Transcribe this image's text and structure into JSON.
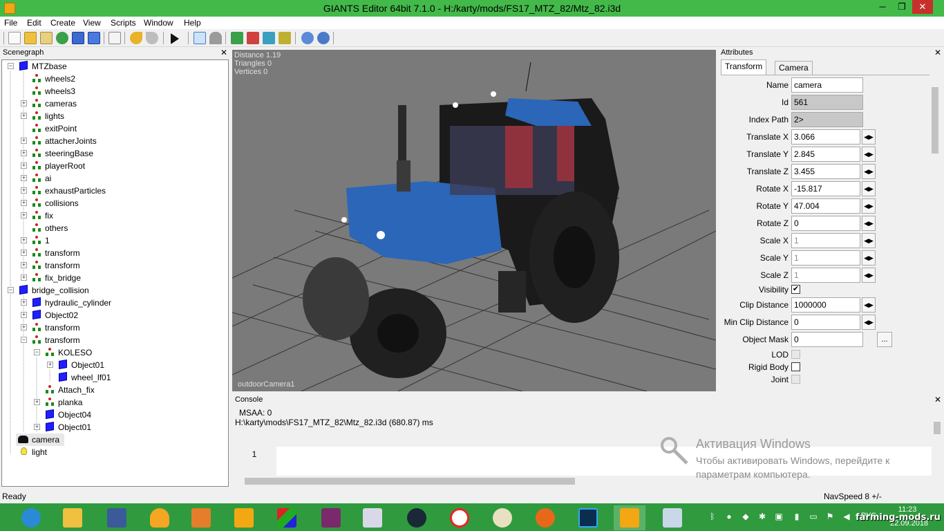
{
  "window": {
    "title": "GIANTS Editor 64bit 7.1.0 - H:/karty/mods/FS17_MTZ_82/Mtz_82.i3d",
    "minimize": "─",
    "maximize": "❐",
    "close": "✕"
  },
  "menu": [
    "File",
    "Edit",
    "Create",
    "View",
    "Scripts",
    "Window",
    "Help"
  ],
  "scenegraph": {
    "title": "Scenegraph",
    "close": "✕",
    "nodes": [
      "MTZbase",
      "wheels2",
      "wheels3",
      "cameras",
      "lights",
      "exitPoint",
      "attacherJoints",
      "steeringBase",
      "playerRoot",
      "ai",
      "exhaustParticles",
      "collisions",
      "fix",
      "others",
      "1",
      "transform",
      "transform",
      "fix_bridge",
      "bridge_collision",
      "hydraulic_cylinder",
      "Object02",
      "transform",
      "transform",
      "KOLESO",
      "Object01",
      "wheel_lf01",
      "Attach_fix",
      "planka",
      "Object04",
      "Object01",
      "camera",
      "light"
    ]
  },
  "viewport": {
    "distance": "Distance 1.19",
    "triangles": "Triangles 0",
    "vertices": "Vertices 0",
    "camera": "outdoorCamera1"
  },
  "attributes": {
    "title": "Attributes",
    "close": "✕",
    "tabs": [
      "Transform",
      "Camera"
    ],
    "fields": {
      "name_label": "Name",
      "name": "camera",
      "id_label": "Id",
      "id": "561",
      "index_label": "Index Path",
      "index": "2>",
      "tx_label": "Translate X",
      "tx": "3.066",
      "ty_label": "Translate Y",
      "ty": "2.845",
      "tz_label": "Translate Z",
      "tz": "3.455",
      "rx_label": "Rotate X",
      "rx": "-15.817",
      "ry_label": "Rotate Y",
      "ry": "47.004",
      "rz_label": "Rotate Z",
      "rz": "0",
      "sx_label": "Scale X",
      "sx": "1",
      "sy_label": "Scale Y",
      "sy": "1",
      "sz_label": "Scale Z",
      "sz": "1",
      "vis_label": "Visibility",
      "vis_check": "✔",
      "clip_label": "Clip Distance",
      "clip": "1000000",
      "minclip_label": "Min Clip Distance",
      "minclip": "0",
      "mask_label": "Object Mask",
      "mask": "0",
      "mask_btn": "...",
      "lod_label": "LOD",
      "rigid_label": "Rigid Body",
      "joint_label": "Joint"
    },
    "spin_glyph": "◀▶"
  },
  "console": {
    "title": "Console",
    "close": "✕",
    "lines": [
      "MSAA: 0",
      "H:\\karty\\mods\\FS17_MTZ_82\\Mtz_82.i3d (680.87) ms"
    ],
    "line_number": "1"
  },
  "watermark": {
    "title": "Активация Windows",
    "line1": "Чтобы активировать Windows, перейдите к",
    "line2": "параметрам компьютера."
  },
  "status": {
    "left": "Ready",
    "right": "NavSpeed 8 +/-"
  },
  "taskbar": {
    "time": "11:23",
    "date": "22.09.2018",
    "lang": "РУС",
    "brand": "farming-mods.ru"
  }
}
